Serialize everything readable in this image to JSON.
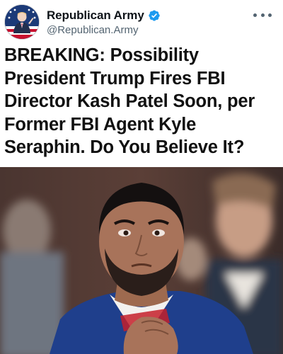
{
  "post": {
    "display_name": "Republican Army",
    "handle": "@Republican.Army",
    "verified": true,
    "headline": "BREAKING: Possibility President Trump Fires FBI Director Kash Patel Soon, per Former FBI Agent Kyle Seraphin. Do You Believe It?"
  },
  "icons": {
    "verified": "verified-badge-icon",
    "more": "more-options-icon"
  },
  "colors": {
    "verified_blue": "#1d9bf0",
    "secondary_text": "#536471",
    "avatar_bg": "#1c3a78",
    "avatar_accent": "#c8102e"
  }
}
